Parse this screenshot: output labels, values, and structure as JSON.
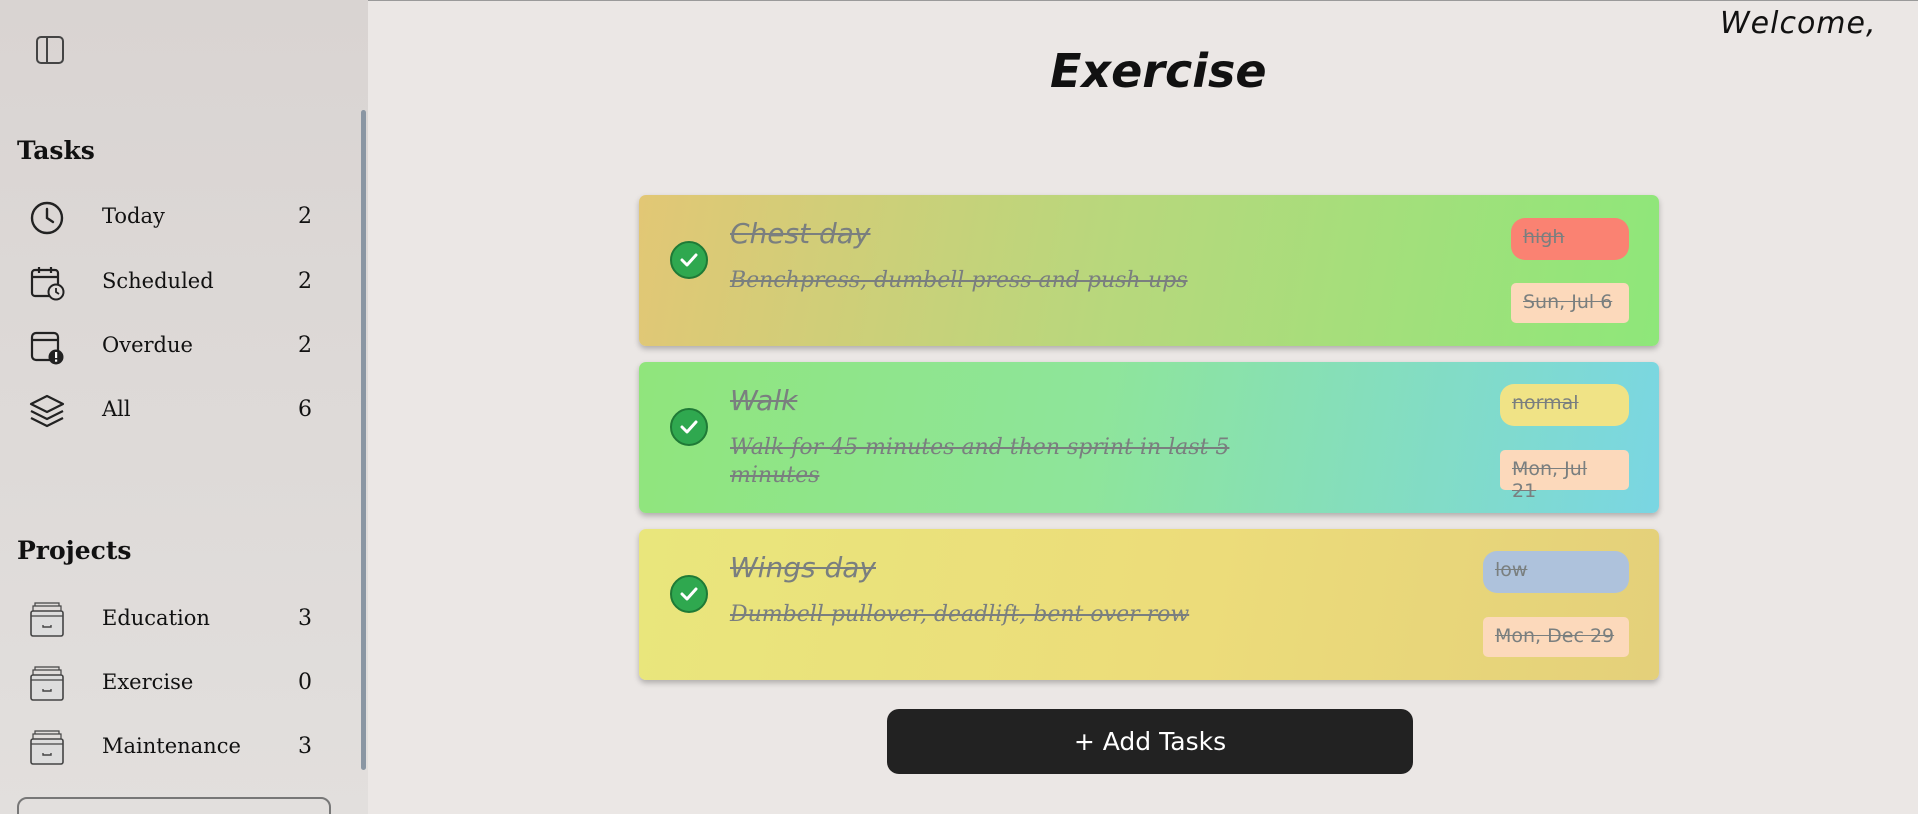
{
  "sidebar": {
    "tasks_title": "Tasks",
    "tasks": [
      {
        "label": "Today",
        "count": "2",
        "icon": "clock-icon"
      },
      {
        "label": "Scheduled",
        "count": "2",
        "icon": "calendar-clock-icon"
      },
      {
        "label": "Overdue",
        "count": "2",
        "icon": "calendar-alert-icon"
      },
      {
        "label": "All",
        "count": "6",
        "icon": "layers-icon"
      }
    ],
    "projects_title": "Projects",
    "projects": [
      {
        "label": "Education",
        "count": "3",
        "icon": "drawer-icon"
      },
      {
        "label": "Exercise",
        "count": "0",
        "icon": "drawer-icon"
      },
      {
        "label": "Maintenance",
        "count": "3",
        "icon": "drawer-icon"
      }
    ]
  },
  "header": {
    "welcome": "Welcome,",
    "title": "Exercise"
  },
  "tasks": [
    {
      "title": "Chest day",
      "description": "Benchpress, dumbell press and push-ups",
      "priority": "high",
      "date": "Sun, Jul 6"
    },
    {
      "title": "Walk",
      "description": "Walk for 45 minutes and then sprint in last 5 minutes",
      "priority": "normal",
      "date": "Mon, Jul 21"
    },
    {
      "title": "Wings day",
      "description": "Dumbell pullover, deadlift, bent over row",
      "priority": "low",
      "date": "Mon, Dec 29"
    }
  ],
  "add_button_label": "+ Add Tasks",
  "colors": {
    "priority_high": "#fa8272",
    "priority_normal": "#f0e386",
    "priority_low": "#aec2dc",
    "date_badge": "#fcd9bb",
    "check": "#2fa84f"
  }
}
